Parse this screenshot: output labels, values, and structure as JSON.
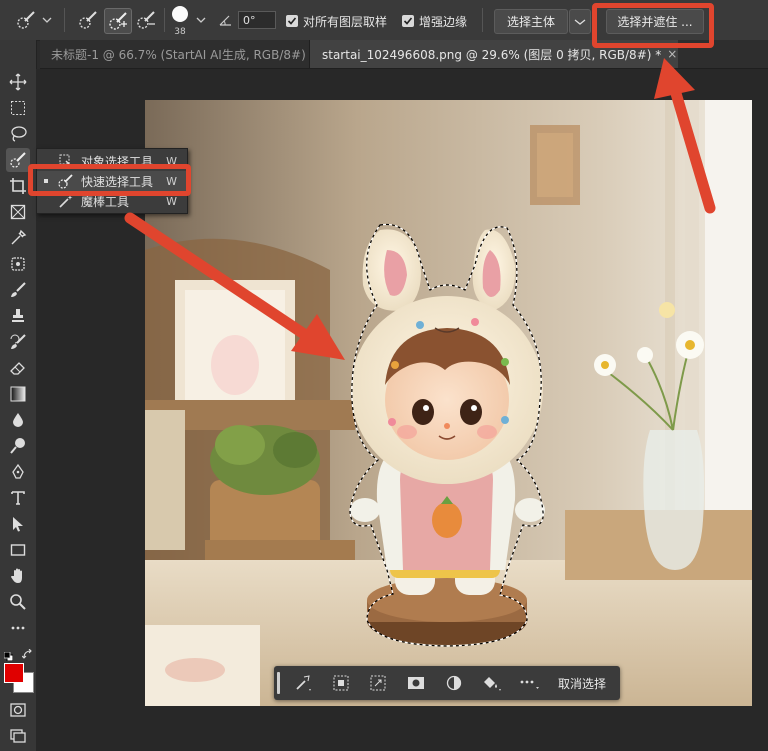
{
  "options_bar": {
    "brush_size": "38",
    "angle_value": "0°",
    "sample_all_layers_label": "对所有图层取样",
    "enhance_edge_label": "增强边缘",
    "select_subject_label": "选择主体",
    "select_and_mask_label": "选择并遮住 ..."
  },
  "tabs": [
    {
      "label": "未标题-1 @ 66.7% (StartAI AI生成, RGB/8#) *",
      "close": "×"
    },
    {
      "label": "startai_102496608.png @ 29.6% (图层 0 拷贝, RGB/8#) *",
      "close": "×"
    }
  ],
  "tool_flyout": {
    "items": [
      {
        "label": "对象选择工具",
        "shortcut": "W"
      },
      {
        "label": "快速选择工具",
        "shortcut": "W"
      },
      {
        "label": "魔棒工具",
        "shortcut": "W"
      }
    ]
  },
  "context_bar": {
    "deselect_label": "取消选择"
  },
  "colors": {
    "foreground": "#e00000",
    "background": "#ffffff",
    "highlight": "#e0452e"
  }
}
